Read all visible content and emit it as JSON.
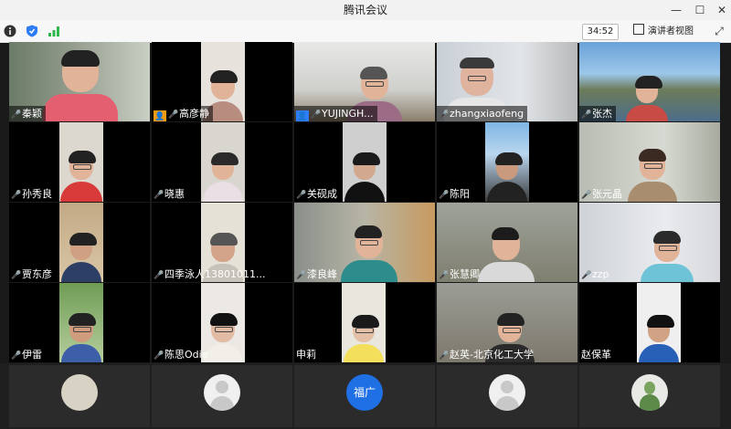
{
  "window": {
    "title": "腾讯会议",
    "min_glyph": "—",
    "max_glyph": "☐",
    "close_glyph": "✕"
  },
  "toolbar": {
    "info_icon": "info-icon",
    "shield_icon": "shield-icon",
    "signal_icon": "signal-icon",
    "timer": "34:52",
    "speaker_view_label": "演讲者视图",
    "fullscreen_glyph": "⤢"
  },
  "participants": [
    {
      "name": "秦颖",
      "mic": "muted"
    },
    {
      "name": "高彦静",
      "mic": "muted",
      "badge": "user-icon"
    },
    {
      "name": "YUJINGH...",
      "mic": "muted",
      "badge": "user-icon"
    },
    {
      "name": "zhangxiaofeng",
      "mic": "on"
    },
    {
      "name": "张杰",
      "mic": "muted"
    },
    {
      "name": "孙秀良",
      "mic": "muted"
    },
    {
      "name": "晓惠",
      "mic": "muted"
    },
    {
      "name": "关砚成",
      "mic": "muted"
    },
    {
      "name": "陈阳",
      "mic": "muted"
    },
    {
      "name": "张元晶",
      "mic": "muted"
    },
    {
      "name": "贾东彦",
      "mic": "muted"
    },
    {
      "name": "四季泳人13801011...",
      "mic": "muted"
    },
    {
      "name": "漆良峰",
      "mic": "muted"
    },
    {
      "name": "张慧卿",
      "mic": "muted"
    },
    {
      "name": "zzp",
      "mic": "muted"
    },
    {
      "name": "伊雷",
      "mic": "muted"
    },
    {
      "name": "陈思Odie",
      "mic": "muted"
    },
    {
      "name": "申莉",
      "mic": "none"
    },
    {
      "name": "赵英-北京化工大学",
      "mic": "on"
    },
    {
      "name": "赵保革",
      "mic": "none"
    }
  ],
  "bottom_row": [
    {
      "avatar": "photo"
    },
    {
      "avatar": "default-user"
    },
    {
      "avatar": "text",
      "avatar_text": "福广"
    },
    {
      "avatar": "default-user"
    },
    {
      "avatar": "photo"
    }
  ],
  "colors": {
    "titlebar": "#f2f2f2",
    "tile_bg": "#000000",
    "mic_muted": "#ff6b6b",
    "mic_on": "#4cd964",
    "avatar_blue": "#1f6fe5"
  }
}
